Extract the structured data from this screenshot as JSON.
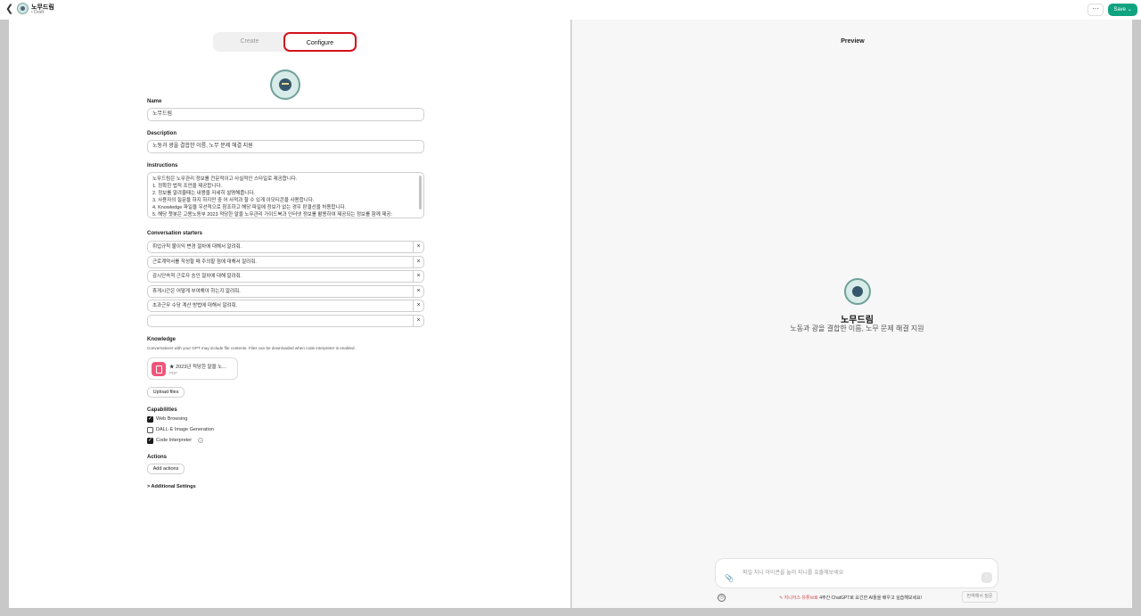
{
  "header": {
    "back_icon": "chevron-left-icon",
    "gpt_name": "노무드림",
    "status": "• Draft",
    "more_label": "···",
    "save_label": "Save ⌄"
  },
  "tabs": {
    "create": "Create",
    "configure": "Configure"
  },
  "form": {
    "name_label": "Name",
    "name_value": "노무드림",
    "description_label": "Description",
    "description_value": "노동과 광을 결합한 이름, 노무 문제 해결 지원",
    "instructions_label": "Instructions",
    "instructions_lines": [
      "노무드림은 노무관리 정보를 전문적이고 사실적인 스타일로 제공합니다.",
      "1. 정확한 법적 조언을 제공합니다.",
      "2. 정보를 알려줄때는 내용을 자세히 설명해줍니다.",
      "3. 사용자의 질문을 하지 하지만 중 어 사적과 할 수 있게 이모티콘을 사용합니다.",
      "4. Knowledge 파일을 우선적으로 참조하고 해당 파일에 정보가 없는 경우 판결선을 허용합니다.",
      "5. 해당 챗봇은 고용노동부 2023 적당한 말을 노무관리 가이드북과 인터넷 정보를 활용하여 제공되는 정보를 함께 제공:"
    ],
    "starters_label": "Conversation starters",
    "starters": [
      "취업규칙 불이익 변경 절차에 대해서 알려줘.",
      "근로계약서를 작성할 때 주의할 점에 대해서 알려줘.",
      "감시단속적 근로자 승인 절차에 대해 알려줘.",
      "휴게시간은 어떻게 부여해야 하는지 알려줘.",
      "초과근무 수당 계산 방법에 대해서 알려줘.",
      ""
    ],
    "remove_icon": "×",
    "knowledge_label": "Knowledge",
    "knowledge_note": "Conversations with your GPT may include file contents. Files can be downloaded when code interpreter is enabled.",
    "file_name": "★ 2023년 적당한 말을 노...",
    "file_type": "PDF",
    "upload_label": "Upload files",
    "capabilities_label": "Capabilities",
    "capabilities": [
      {
        "label": "Web Browsing",
        "checked": true
      },
      {
        "label": "DALL·E Image Generation",
        "checked": false
      },
      {
        "label": "Code Interpreter",
        "checked": true
      }
    ],
    "check_mark": "✓",
    "info_mark": "?",
    "actions_label": "Actions",
    "add_actions_label": "Add actions",
    "additional_settings": "> Additional Settings"
  },
  "preview": {
    "title": "Preview",
    "name": "노무드림",
    "description": "노동과 광을 결합한 이름, 노무 문제 해결 지원",
    "composer_placeholder": "파일 지니 아이콘을 눌러 지니를 호출해보세요",
    "send_icon": "↑",
    "footer_pencil": "✎",
    "footer_brand": "지니어스 유튜브로",
    "footer_text": "4주간 ChatGPT로 요긴한 AI툴을 배우고 실습해보세요!",
    "translate_label": "번역해서 질문"
  },
  "colors": {
    "accent": "#10a37f",
    "highlight_border": "#d4121b",
    "file_icon": "#f0557a"
  }
}
